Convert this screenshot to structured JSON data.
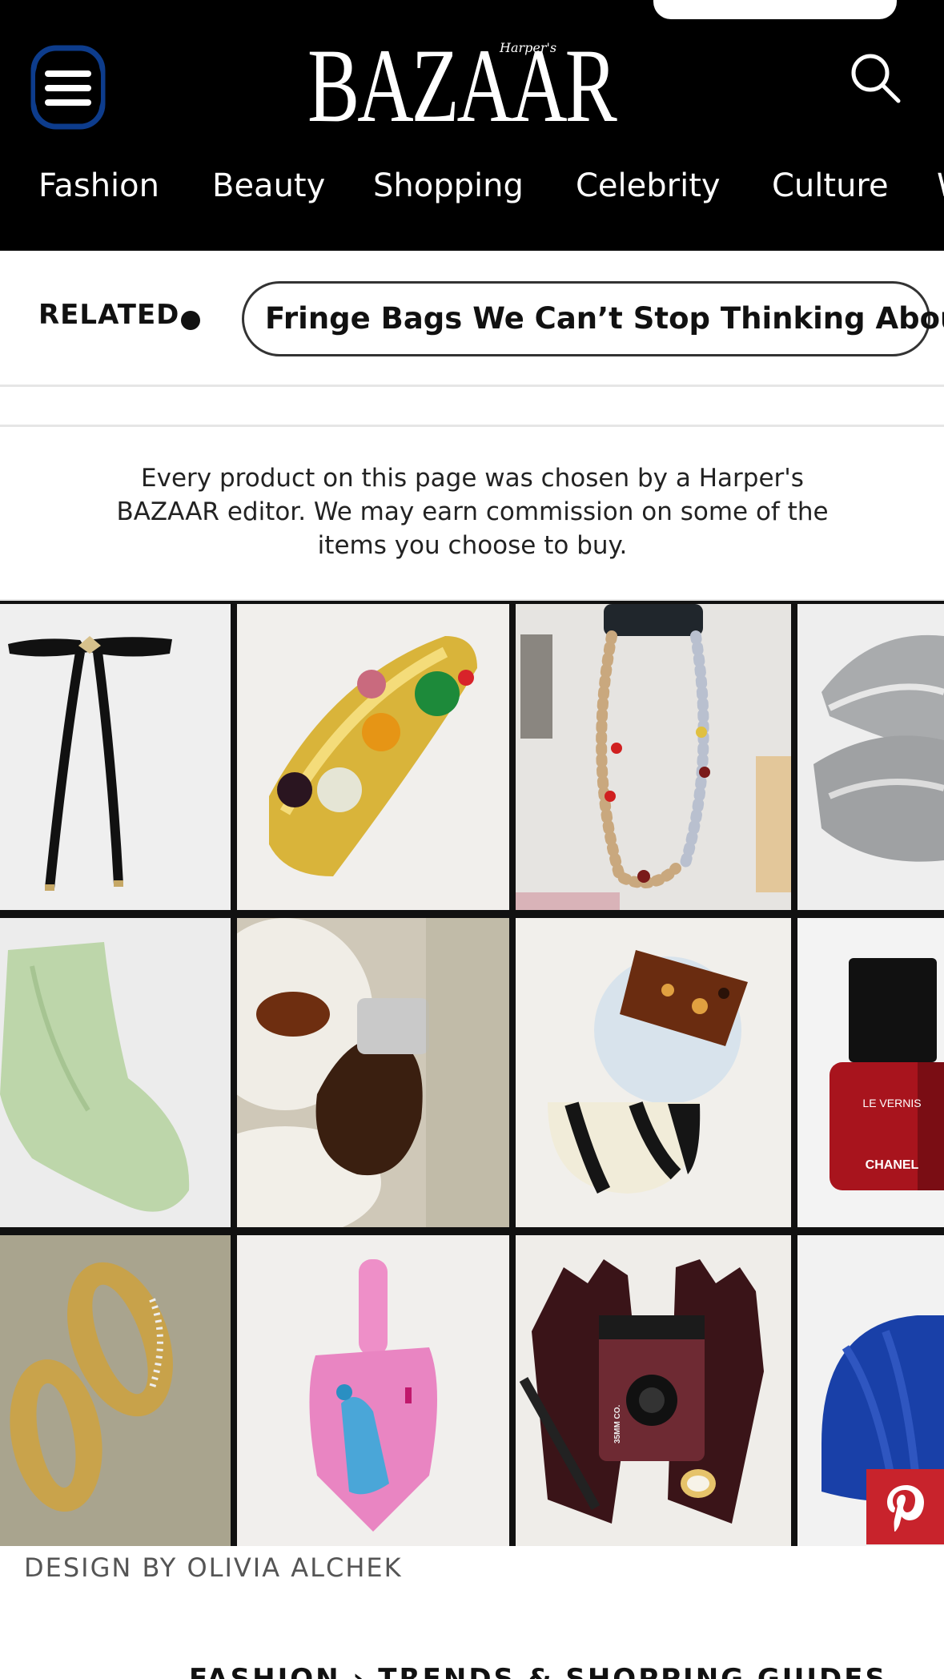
{
  "header": {
    "logo_small": "Harper's",
    "logo": "BAZAAR",
    "nav": [
      "Fashion",
      "Beauty",
      "Shopping",
      "Celebrity",
      "Culture",
      "W"
    ]
  },
  "related": {
    "label": "RELATED",
    "link": "Fringe Bags We Can’t Stop Thinking About"
  },
  "disclaimer": "Every product on this page was chosen by a Harper's BAZAAR editor. We may earn commission on some of the items you choose to buy.",
  "image": {
    "credit": "DESIGN BY OLIVIA ALCHEK",
    "nail_polish_label_1": "LE VERNIS",
    "nail_polish_label_2": "CHANEL",
    "camera_text": "35MM CO."
  },
  "breadcrumb": "FASHION › TRENDS & SHOPPING GUIDES",
  "icons": {
    "menu": "hamburger-menu-icon",
    "search": "search-icon",
    "pinterest": "pinterest-icon"
  },
  "colors": {
    "header_bg": "#000000",
    "menu_ring": "#0d3c8c",
    "pinterest_red": "#c8232c"
  }
}
